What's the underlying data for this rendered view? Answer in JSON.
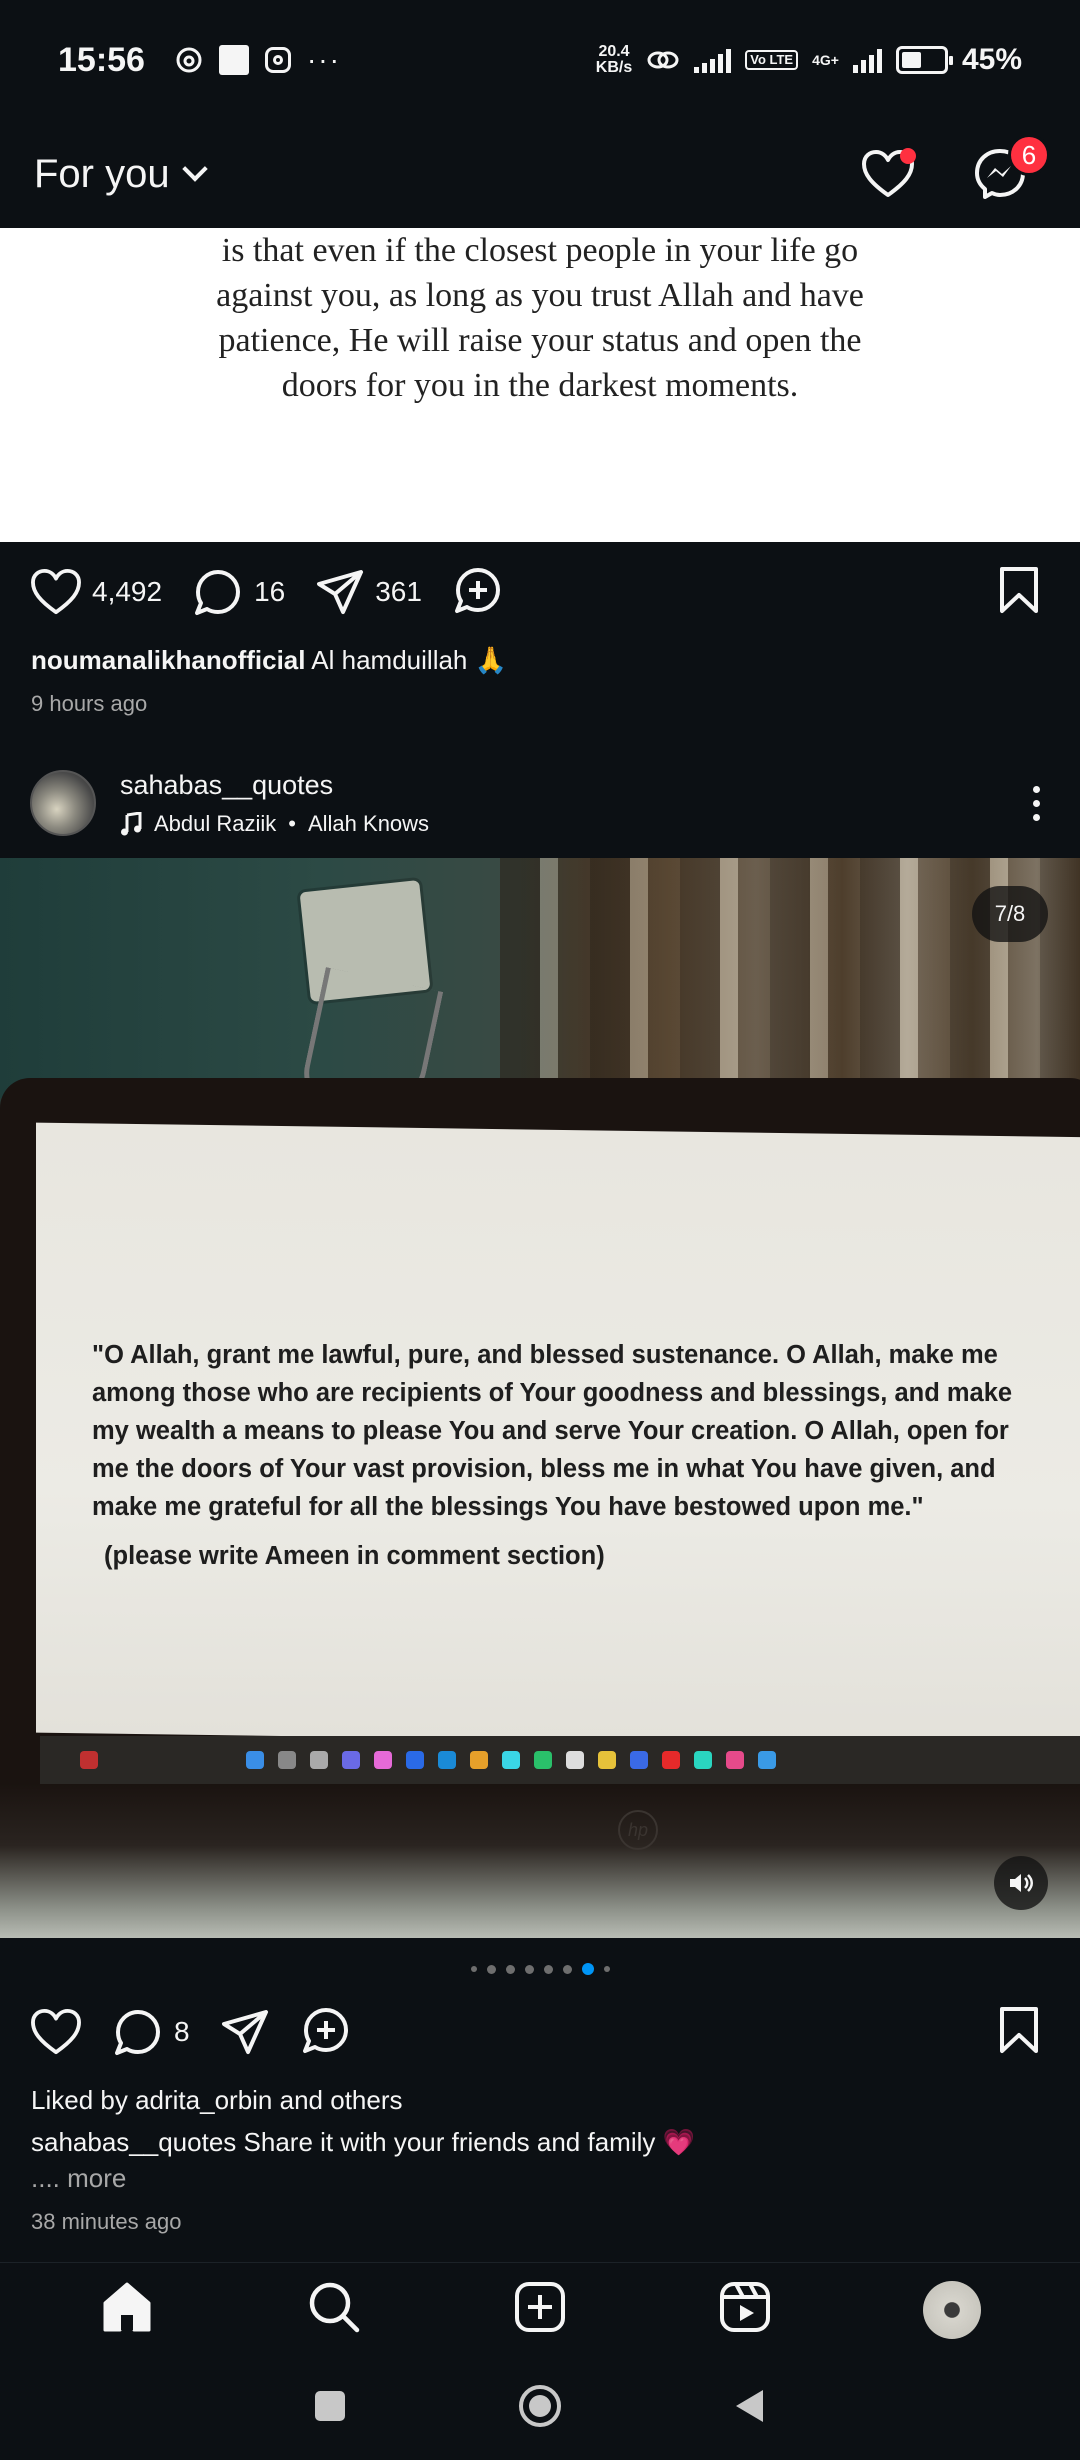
{
  "status_bar": {
    "time": "15:56",
    "net_speed_value": "20.4",
    "net_speed_unit": "KB/s",
    "volte_label": "Vo LTE",
    "network_label": "4G+",
    "battery_percent": "45%",
    "battery_level": 0.45,
    "more_indicator": "···"
  },
  "header": {
    "title": "For you",
    "notifications_icon": "heart-icon",
    "messenger_icon": "messenger-icon",
    "messenger_badge": "6"
  },
  "post1": {
    "image_text": "is that even if the closest people in your life go against you, as long as you trust Allah and have patience, He will raise your status and open the doors for you in the darkest moments.",
    "likes": "4,492",
    "comments": "16",
    "shares": "361",
    "caption_user": "noumanalikhanofficial",
    "caption_text": "Al hamduillah 🙏",
    "time_ago": "9 hours ago"
  },
  "post2": {
    "username": "sahabas__quotes",
    "music_artist": "Abdul Raziik",
    "music_separator": "•",
    "music_title": "Allah Knows",
    "page_counter": "7/8",
    "current_slide": 7,
    "total_slides": 8,
    "screen_quote": "\"O Allah, grant me lawful, pure, and blessed sustenance. O Allah, make me among those who are recipients of Your goodness and blessings, and make my wealth a means to please You and serve Your creation. O Allah, open for me the doors of Your vast provision, bless me in what You have given, and make me grateful for all the blessings You have bestowed upon me.\"",
    "screen_subtext": "(please write Ameen in comment section)",
    "comments": "8",
    "liked_by_prefix": "Liked by",
    "liked_by_user": "adrita_orbin",
    "liked_by_suffix": "and others",
    "caption_user": "sahabas__quotes",
    "caption_text": "Share it with your friends and family 💗",
    "more_label": ".... more",
    "time_ago": "38 minutes ago"
  },
  "bottom_nav": {
    "items": [
      "home-icon",
      "search-icon",
      "create-icon",
      "reels-icon",
      "profile-avatar"
    ]
  },
  "colors": {
    "background": "#0c1014",
    "badge_red": "#ff3040",
    "active_dot_blue": "#0095f6",
    "muted_text": "#a8a8a8"
  }
}
